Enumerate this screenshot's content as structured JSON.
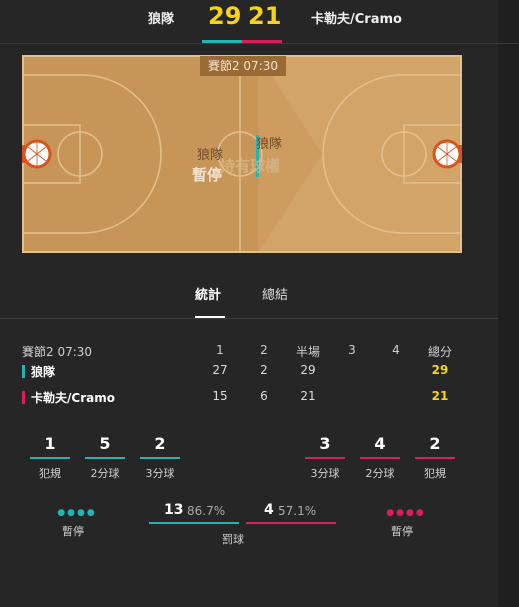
{
  "header": {
    "home_team": "狼隊",
    "home_score": "29",
    "away_score": "21",
    "away_team": "卡勒夫/Cramo"
  },
  "colors": {
    "home": "#20b5b5",
    "away": "#d81f5a",
    "score": "#f7d21b",
    "court": "#c89559"
  },
  "court": {
    "period_time": "賽節2 07:30",
    "left_team": "狼隊",
    "status": "暫停",
    "right_team": "狼隊",
    "possession": "持有球權"
  },
  "tabs": [
    {
      "label": "統計",
      "active": true
    },
    {
      "label": "總結",
      "active": false
    }
  ],
  "quarter_table": {
    "header_label": "賽節2 07:30",
    "columns": [
      "1",
      "2",
      "半場",
      "3",
      "4",
      "總分"
    ],
    "rows": [
      {
        "team": "狼隊",
        "values": [
          "27",
          "2",
          "29",
          "",
          "",
          "29"
        ]
      },
      {
        "team": "卡勒夫/Cramo",
        "values": [
          "15",
          "6",
          "21",
          "",
          "",
          "21"
        ]
      }
    ]
  },
  "team_stats": {
    "home": [
      {
        "value": "1",
        "label": "犯規"
      },
      {
        "value": "5",
        "label": "2分球"
      },
      {
        "value": "2",
        "label": "3分球"
      }
    ],
    "away": [
      {
        "value": "3",
        "label": "3分球"
      },
      {
        "value": "4",
        "label": "2分球"
      },
      {
        "value": "2",
        "label": "犯規"
      }
    ]
  },
  "timeouts": {
    "label": "暫停",
    "home_remaining": 4,
    "away_remaining": 4
  },
  "free_throws": {
    "label": "罰球",
    "home_made": "13",
    "home_pct": "86.7%",
    "away_made": "4",
    "away_pct": "57.1%"
  }
}
